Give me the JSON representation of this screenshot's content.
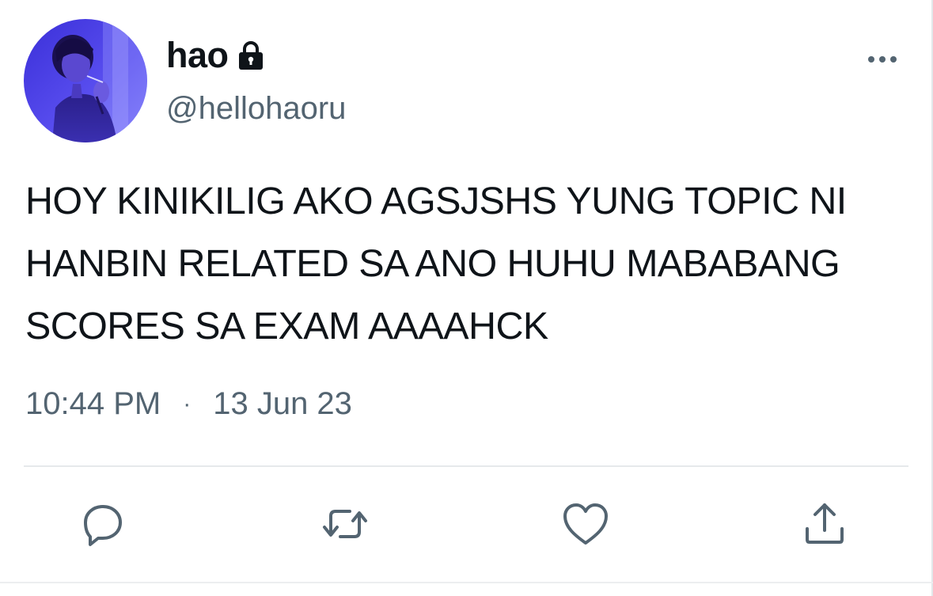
{
  "tweet": {
    "display_name": "hao",
    "handle": "@hellohaoru",
    "text": "HOY KINIKILIG AKO AGSJSHS YUNG TOPIC NI HANBIN RELATED SA ANO HUHU MABABANG SCORES SA EXAM AAAAHCK",
    "time": "10:44 PM",
    "separator": "·",
    "date": "13 Jun 23"
  },
  "icons": {
    "lock": "lock-icon",
    "more": "more-horizontal-icon",
    "reply": "reply-icon",
    "retweet": "retweet-icon",
    "like": "heart-icon",
    "share": "share-icon"
  },
  "colors": {
    "text_primary": "#0f1419",
    "text_secondary": "#536471",
    "divider": "#e6e9eb"
  }
}
